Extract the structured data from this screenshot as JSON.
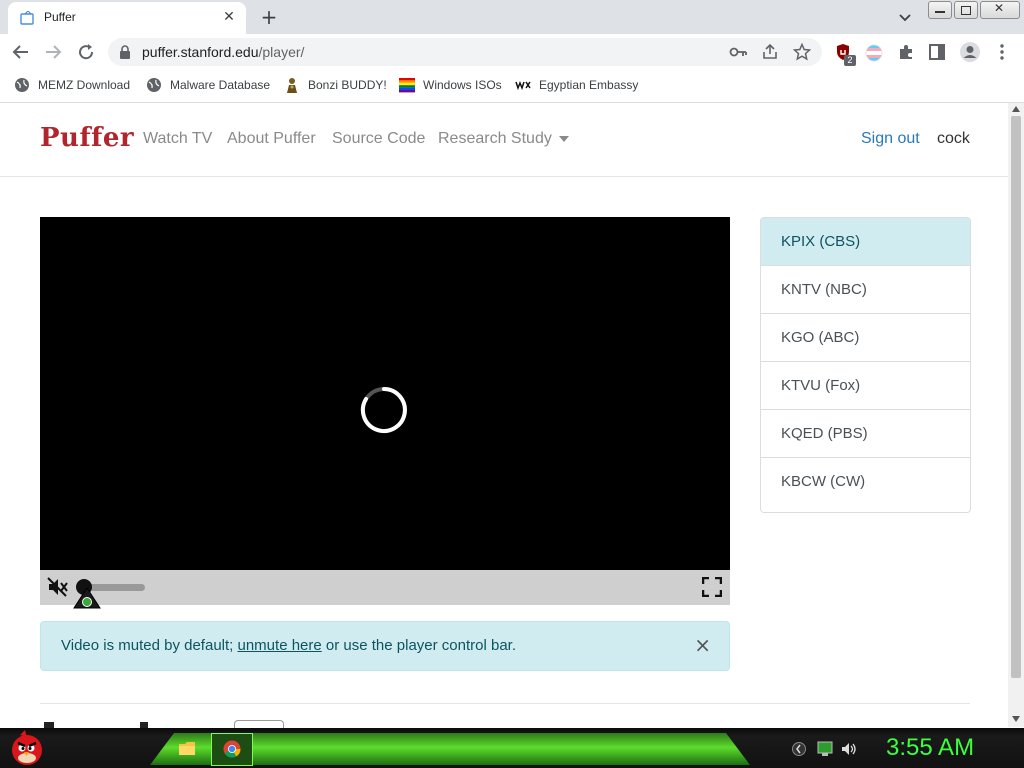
{
  "browser": {
    "tab_title": "Puffer",
    "new_tab": "+",
    "url_host": "puffer.stanford.edu",
    "url_path": "/player/",
    "extension_badge": "2"
  },
  "bookmarks": [
    {
      "label": "MEMZ Download"
    },
    {
      "label": "Malware Database"
    },
    {
      "label": "Bonzi BUDDY!"
    },
    {
      "label": "Windows ISOs"
    },
    {
      "label": "Egyptian Embassy"
    }
  ],
  "site": {
    "brand": "Puffer",
    "nav": [
      "Watch TV",
      "About Puffer",
      "Source Code",
      "Research Study"
    ],
    "sign_out": "Sign out",
    "username": "cock"
  },
  "player": {
    "alert_prefix": "Video is muted by default; ",
    "alert_link": "unmute here",
    "alert_suffix": " or use the player control bar.",
    "alert_close": "×"
  },
  "channels": [
    "KPIX (CBS)",
    "KNTV (NBC)",
    "KGO (ABC)",
    "KTVU (Fox)",
    "KQED (PBS)",
    "KBCW (CW)"
  ],
  "taskbar": {
    "clock": "3:55 AM"
  },
  "colors": {
    "brand": "#b0262c",
    "link": "#2a7ab8",
    "alert_bg": "#d1ecf1",
    "clock": "#3cff3c"
  }
}
